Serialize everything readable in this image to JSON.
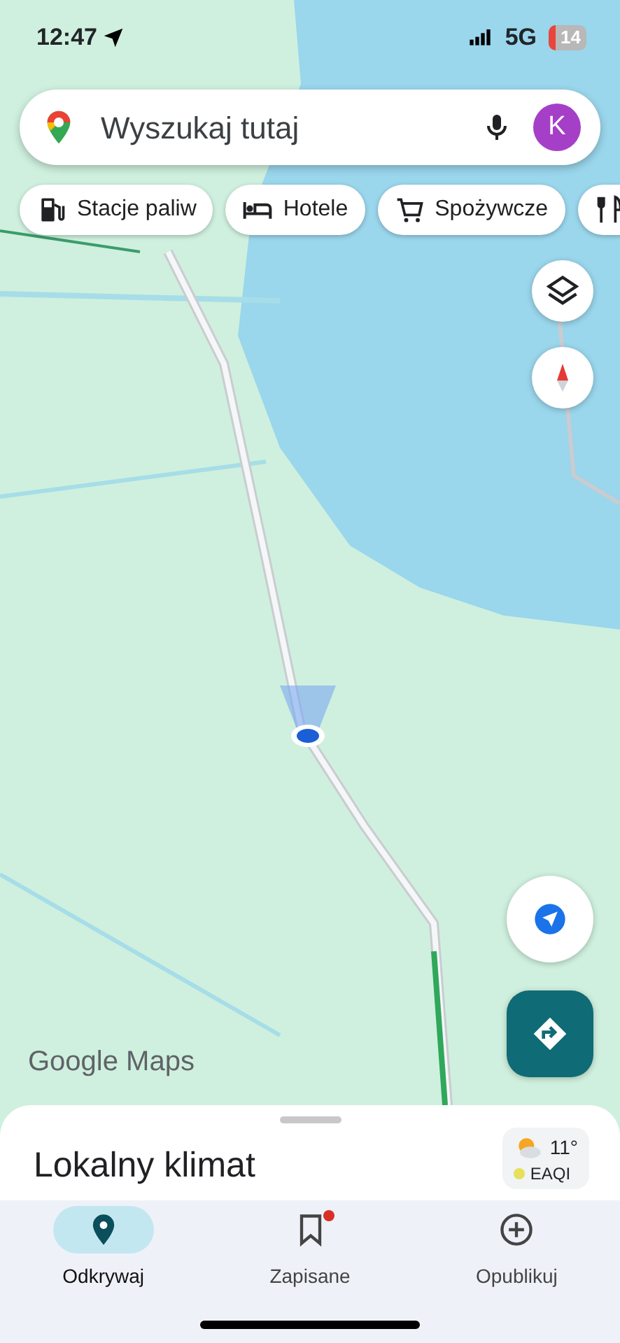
{
  "status_bar": {
    "time": "12:47",
    "network": "5G",
    "battery": "14"
  },
  "search": {
    "placeholder": "Wyszukaj tutaj",
    "avatar": "K"
  },
  "chips": [
    {
      "label": "Stacje paliw",
      "kind": "fuel"
    },
    {
      "label": "Hotele",
      "kind": "hotel"
    },
    {
      "label": "Spożywcze",
      "kind": "cart"
    },
    {
      "kind": "restaurant"
    }
  ],
  "logo": "Google Maps",
  "sheet": {
    "title": "Lokalny klimat",
    "temperature": "11°",
    "air_quality": "EAQI"
  },
  "nav": [
    {
      "label": "Odkrywaj",
      "kind": "explore",
      "selected": true,
      "badge": false
    },
    {
      "label": "Zapisane",
      "kind": "saved",
      "selected": false,
      "badge": true
    },
    {
      "label": "Opublikuj",
      "kind": "add",
      "selected": false,
      "badge": false
    }
  ]
}
